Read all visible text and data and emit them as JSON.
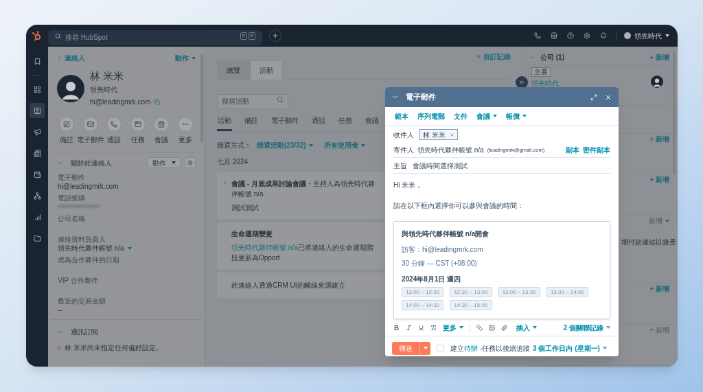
{
  "topbar": {
    "search": {
      "placeholder": "搜尋 HubSpot"
    },
    "shortcut_keys": [
      "⌘",
      "K"
    ],
    "account": "領先時代"
  },
  "nav": [
    {
      "selected": false
    },
    {
      "selected": false
    },
    {
      "selected": true
    },
    {
      "selected": false
    },
    {
      "selected": false
    },
    {
      "selected": false
    },
    {
      "selected": false
    },
    {
      "selected": false
    },
    {
      "selected": false
    }
  ],
  "contact": {
    "back_link": "連絡人",
    "actions_menu": "動作",
    "name": "林 米米",
    "company": "領先時代",
    "email": "hi@leadingmrk.com",
    "quick_actions": [
      "備註",
      "電子郵件",
      "通話",
      "任務",
      "會議",
      "更多"
    ]
  },
  "about": {
    "title": "關於此連絡人",
    "expanded": true,
    "actions_button": "動作",
    "fields": [
      {
        "kind": "text",
        "label": "電子郵件",
        "value": "hi@leadingmrk.com"
      },
      {
        "kind": "redacted",
        "label": "電話號碼"
      },
      {
        "kind": "empty",
        "label": "公司名稱"
      },
      {
        "kind": "owner",
        "label": "連絡資料負責人",
        "value": "領先時代夥伴帳號 n/a"
      },
      {
        "kind": "empty",
        "label": "成為合作夥伴的日期"
      },
      {
        "kind": "empty",
        "label": "VIP 合作夥伴"
      },
      {
        "kind": "text",
        "label": "最近的交易金額",
        "value": "--"
      }
    ]
  },
  "subscriptions": {
    "title": "通訊訂閱",
    "expanded": true,
    "status": "林 米米尚未指定任何偏好設定。"
  },
  "activity": {
    "customize_link": "自訂記錄",
    "tabs": [
      {
        "label": "總覽",
        "selected": false
      },
      {
        "label": "活動",
        "selected": true
      }
    ],
    "search": {
      "placeholder": "搜尋活動"
    },
    "type_tabs": [
      {
        "label": "活動",
        "selected": true
      },
      {
        "label": "備註",
        "selected": false
      },
      {
        "label": "電子郵件",
        "selected": false
      },
      {
        "label": "通話",
        "selected": false
      },
      {
        "label": "任務",
        "selected": false
      },
      {
        "label": "會議",
        "selected": false
      }
    ],
    "filter_label": "篩選方式：",
    "filter_activities": "篩選活動(23/32)",
    "filter_users": "所有使用者",
    "month": "七月 2024",
    "items": [
      {
        "kind": "meeting",
        "title": "**會議 - 月底成果討論會議**・主持人為領先時代夥伴帳號 n/a",
        "body": "測試測試"
      },
      {
        "kind": "lifecycle",
        "title": "生命週期變更",
        "link": "領先時代夥伴帳號 n/a",
        "body": "已將連絡人的生命週期階段更新為Opport"
      },
      {
        "kind": "note",
        "body": "此連絡人透過CRM UI的離線來源建立"
      }
    ]
  },
  "right_sections": [
    {
      "kind": "company",
      "title": "公司 (1)",
      "add": "+ 新增",
      "disabled": false,
      "tag": "主要",
      "company": "領先時代"
    },
    {
      "kind": "plain",
      "add": "+ 新增",
      "disabled": false
    },
    {
      "kind": "plain",
      "add": "+ 新增",
      "disabled": false
    },
    {
      "kind": "payment",
      "add": "新增",
      "disabled": true,
      "note": "增付款連結以接受"
    },
    {
      "kind": "plain",
      "add": "+ 新增",
      "disabled": false
    },
    {
      "kind": "plain",
      "add": "+ 新增",
      "disabled": true
    }
  ],
  "email_dialog": {
    "title": "電子郵件",
    "toolbar": [
      {
        "label": "範本",
        "dropdown": false
      },
      {
        "label": "序列電郵",
        "dropdown": false
      },
      {
        "label": "文件",
        "dropdown": false
      },
      {
        "label": "會議",
        "dropdown": true
      },
      {
        "label": "報價",
        "dropdown": true
      }
    ],
    "to_label": "收件人",
    "recipients": [
      "林 米米"
    ],
    "from_label": "寄件人",
    "from_name": "領先時代夥伴帳號 n/a",
    "from_email": "(leadingmrk@gmail.com)",
    "cc": "副本",
    "bcc": "密件副本",
    "subject_label": "主旨",
    "subject": "會議時間選擇測試",
    "greeting": "Hi 米米，",
    "intro": "請在以下框內選擇你可以參與會議的時間：",
    "meeting": {
      "title": "與領先時代夥伴帳號 n/a開會",
      "guest": "訪客：hi@leadingmrk.com",
      "duration": "30 分鐘 — CST (+08:00)",
      "date": "2024年8月1日 週四",
      "slots": [
        "12:00 – 12:30",
        "12:30 – 13:00",
        "13:00 – 13:30",
        "13:30 – 14:00",
        "14:00 – 14:30",
        "14:30 – 15:00"
      ]
    },
    "format_more": "更多",
    "insert": "插入",
    "associations": "2 個關聯記錄",
    "send": "傳送",
    "task_checked": false,
    "task_text": "建立",
    "task_link": "待辦",
    "task_rest": " -任務以後續追蹤",
    "due": "3 個工作日內 (星期一)"
  }
}
